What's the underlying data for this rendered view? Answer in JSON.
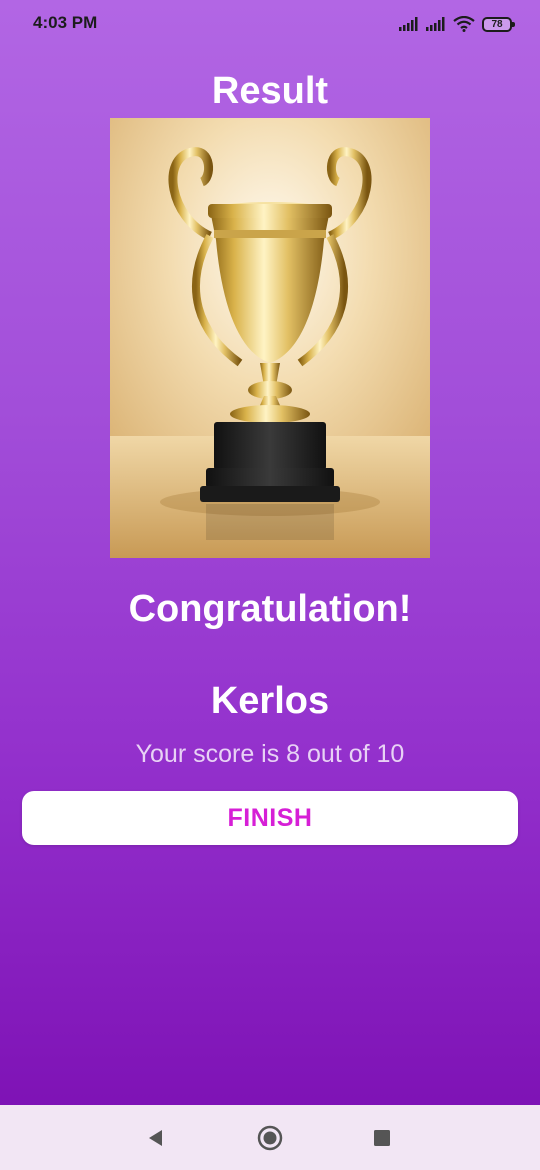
{
  "status_bar": {
    "time": "4:03 PM",
    "battery_level": "78",
    "icons": [
      "signal-icon",
      "signal-icon",
      "wifi-icon",
      "battery-icon"
    ]
  },
  "result": {
    "title": "Result",
    "image": "trophy-image",
    "congratulation_text": "Congratulation!",
    "player_name": "Kerlos",
    "score_text": "Your score is 8 out of 10",
    "finish_label": "FINISH"
  },
  "colors": {
    "background_top": "#b266e4",
    "background_bottom": "#7e12b5",
    "button_background": "#ffffff",
    "button_text": "#d61fd6",
    "nav_bar": "#f2e6f4"
  },
  "navigation": {
    "buttons": [
      "back-icon",
      "home-icon",
      "recents-icon"
    ]
  }
}
